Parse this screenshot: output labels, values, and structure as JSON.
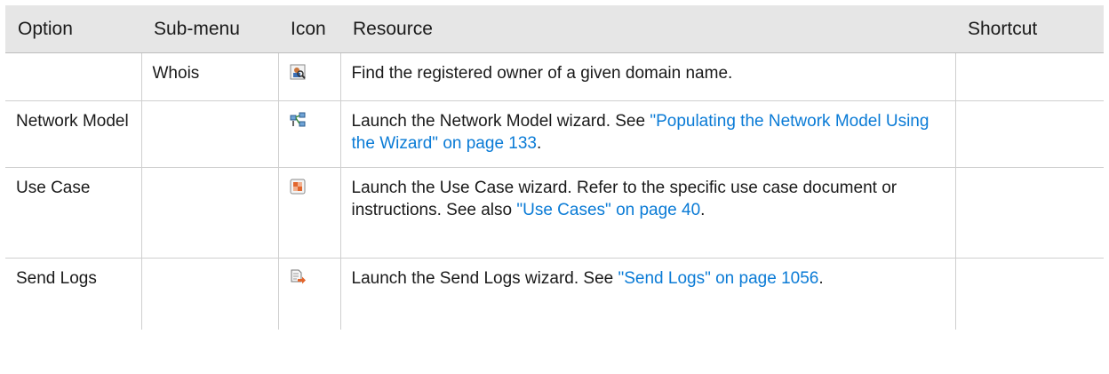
{
  "headers": {
    "option": "Option",
    "submenu": "Sub-menu",
    "icon": "Icon",
    "resource": "Resource",
    "shortcut": "Shortcut"
  },
  "rows": [
    {
      "option": "",
      "submenu": "Whois",
      "icon": "whois-lookup-icon",
      "resource_text": "Find the registered owner of a given domain name.",
      "link": "",
      "resource_tail": "",
      "shortcut": ""
    },
    {
      "option": "Network Model",
      "submenu": "",
      "icon": "network-model-icon",
      "resource_text": "Launch the Network Model wizard. See ",
      "link": "\"Populating the Network Model Using the Wizard\" on page 133",
      "resource_tail": ".",
      "shortcut": ""
    },
    {
      "option": "Use Case",
      "submenu": "",
      "icon": "use-case-icon",
      "resource_text": "Launch the Use Case wizard. Refer to the specific use case document or instructions. See also ",
      "link": "\"Use Cases\" on page 40",
      "resource_tail": ".",
      "shortcut": ""
    },
    {
      "option": "Send Logs",
      "submenu": "",
      "icon": "send-logs-icon",
      "resource_text": "Launch the Send Logs wizard. See ",
      "link": "\"Send Logs\" on page 1056",
      "resource_tail": ".",
      "shortcut": ""
    }
  ]
}
